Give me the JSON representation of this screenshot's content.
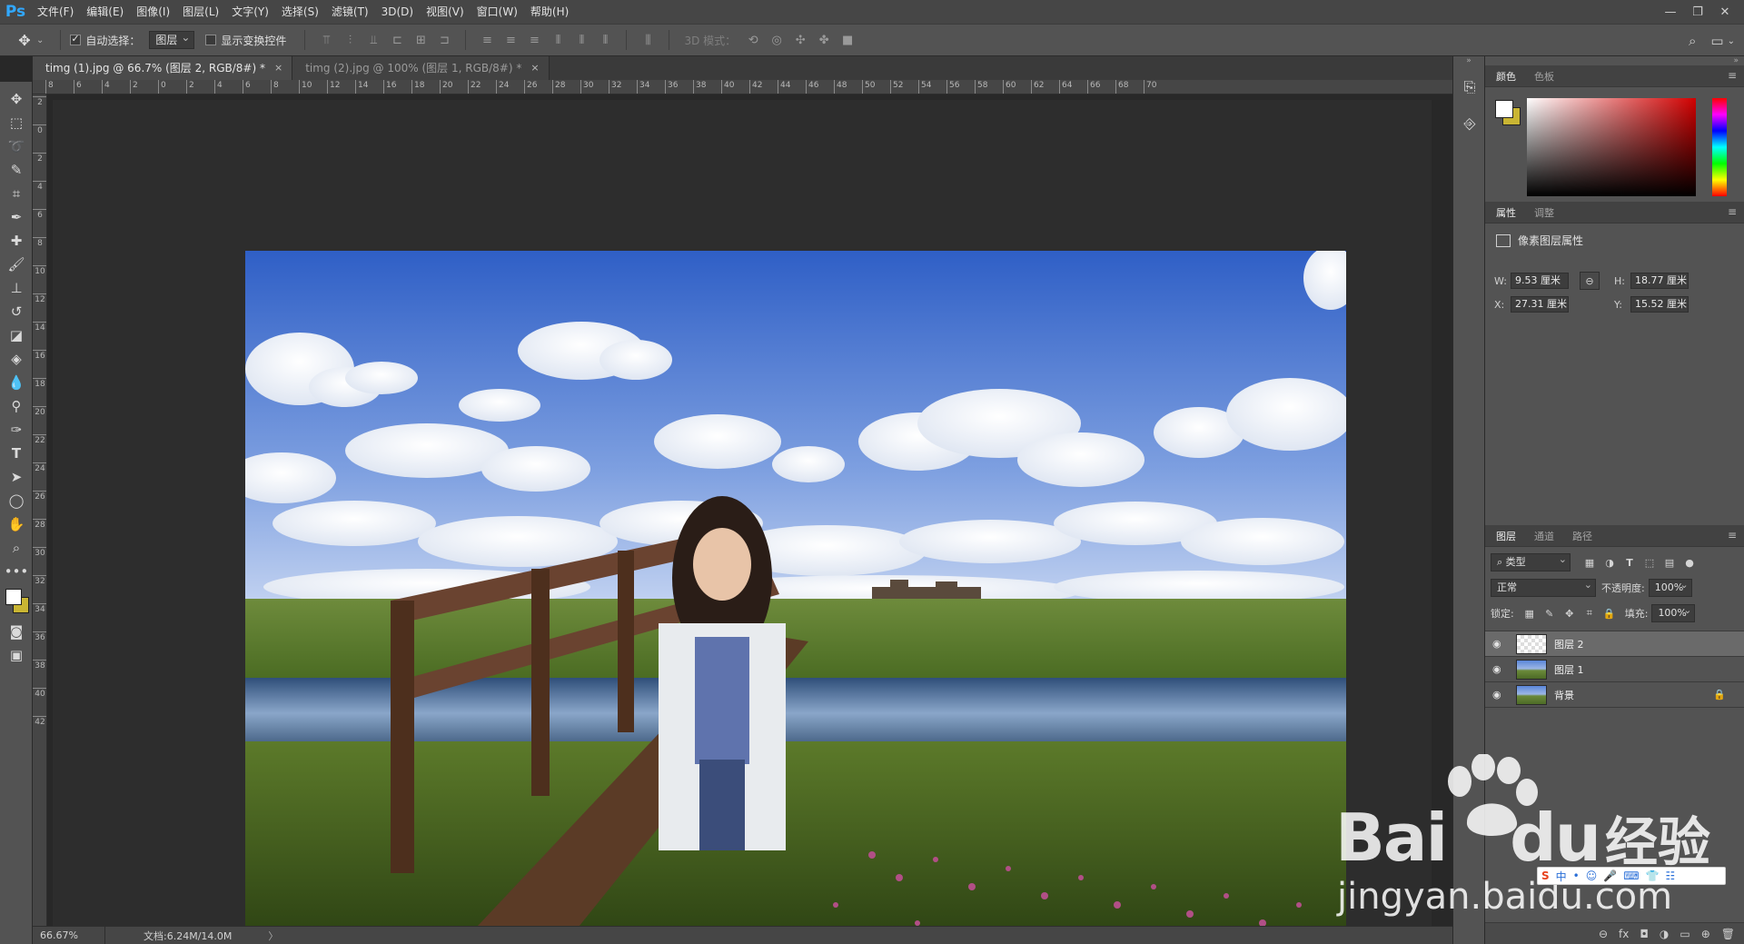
{
  "app": {
    "logo": "Ps",
    "menu": [
      "文件(F)",
      "编辑(E)",
      "图像(I)",
      "图层(L)",
      "文字(Y)",
      "选择(S)",
      "滤镜(T)",
      "3D(D)",
      "视图(V)",
      "窗口(W)",
      "帮助(H)"
    ],
    "window_controls": [
      "—",
      "❐",
      "✕"
    ]
  },
  "options": {
    "auto_select_label": "自动选择：",
    "auto_select_checked": true,
    "auto_select_value": "图层",
    "show_transform_label": "显示变换控件",
    "mode3d_label": "3D 模式："
  },
  "tabs": [
    {
      "label": "timg (1).jpg @ 66.7% (图层 2, RGB/8#) *",
      "active": true,
      "close": "×"
    },
    {
      "label": "timg (2).jpg @ 100% (图层 1, RGB/8#) *",
      "active": false,
      "close": "×"
    }
  ],
  "ruler": {
    "top": [
      "8",
      "6",
      "4",
      "2",
      "0",
      "2",
      "4",
      "6",
      "8",
      "10",
      "12",
      "14",
      "16",
      "18",
      "20",
      "22",
      "24",
      "26",
      "28",
      "30",
      "32",
      "34",
      "36",
      "38",
      "40",
      "42",
      "44",
      "46",
      "48",
      "50",
      "52",
      "54",
      "56",
      "58",
      "60",
      "62",
      "64",
      "66",
      "68",
      "70"
    ],
    "left": [
      "2",
      "0",
      "2",
      "4",
      "6",
      "8",
      "10",
      "12",
      "14",
      "16",
      "18",
      "20",
      "22",
      "24",
      "26",
      "28",
      "30",
      "32",
      "34",
      "36",
      "38",
      "40",
      "42"
    ]
  },
  "status": {
    "zoom": "66.67%",
    "doc": "文档:6.24M/14.0M",
    "arrow": "〉"
  },
  "panels": {
    "color": {
      "tabs": [
        "颜色",
        "色板"
      ],
      "fg": "#ffffff",
      "bg": "#c9b533"
    },
    "properties": {
      "tabs": [
        "属性",
        "调整"
      ],
      "title": "像素图层属性",
      "w_label": "W:",
      "w": "9.53 厘米",
      "h_label": "H:",
      "h": "18.77 厘米",
      "x_label": "X:",
      "x": "27.31 厘米",
      "y_label": "Y:",
      "y": "15.52 厘米"
    },
    "layers": {
      "tabs": [
        "图层",
        "通道",
        "路径"
      ],
      "filter_value": "类型",
      "blend_mode": "正常",
      "opacity_label": "不透明度:",
      "opacity": "100%",
      "lock_label": "锁定:",
      "fill_label": "填充:",
      "fill": "100%",
      "items": [
        {
          "name": "图层 2",
          "active": true,
          "locked": false
        },
        {
          "name": "图层 1",
          "active": false,
          "locked": false
        },
        {
          "name": "背景",
          "active": false,
          "locked": true
        }
      ],
      "footer_icons": [
        "link-icon",
        "fx-icon",
        "mask-icon",
        "adjustment-icon",
        "folder-icon",
        "new-layer-icon",
        "trash-icon"
      ],
      "footer_glyphs": [
        "⊖",
        "fx",
        "◘",
        "◑",
        "▭",
        "⊕",
        "🗑"
      ]
    }
  },
  "watermark": {
    "brand_left": "Bai",
    "brand_right": "du",
    "brand_cn": "经验",
    "url": "jingyan.baidu.com",
    "ime_glyphs": [
      "S",
      "中",
      "•",
      "☺",
      "🎤",
      "⌨",
      "👕",
      "☷"
    ]
  }
}
